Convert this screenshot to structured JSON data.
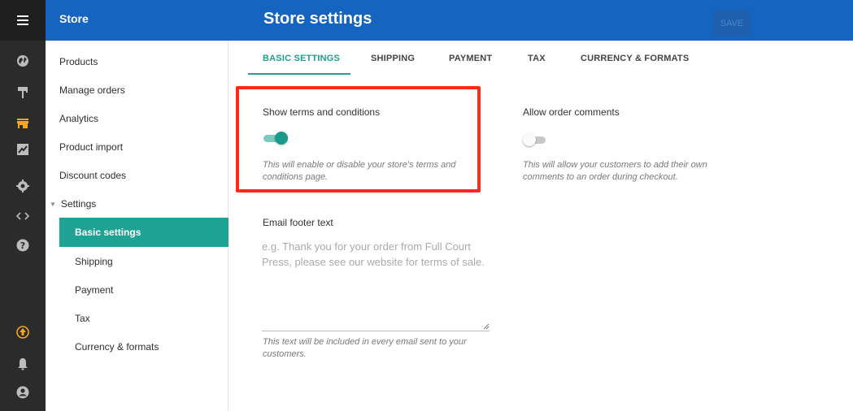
{
  "header": {
    "section": "Store",
    "title": "Store settings",
    "save_label": "SAVE"
  },
  "rail": {
    "icons": [
      "menu-icon",
      "globe-icon",
      "paint-roller-icon",
      "store-icon",
      "chart-icon",
      "gear-icon",
      "code-icon",
      "help-icon",
      "upgrade-icon",
      "bell-icon",
      "account-icon"
    ],
    "accent": "#f5a623"
  },
  "sidebar": {
    "items": [
      "Products",
      "Manage orders",
      "Analytics",
      "Product import",
      "Discount codes"
    ],
    "settings_label": "Settings",
    "sub_items": [
      "Basic settings",
      "Shipping",
      "Payment",
      "Tax",
      "Currency & formats"
    ],
    "active_sub": "Basic settings"
  },
  "tabs": [
    "BASIC SETTINGS",
    "SHIPPING",
    "PAYMENT",
    "TAX",
    "CURRENCY & FORMATS"
  ],
  "settings": {
    "terms": {
      "label": "Show terms and conditions",
      "enabled": true,
      "description": "This will enable or disable your store's terms and conditions page."
    },
    "comments": {
      "label": "Allow order comments",
      "enabled": false,
      "description": "This will allow your customers to add their own comments to an order during checkout."
    },
    "email_footer": {
      "label": "Email footer text",
      "placeholder": "e.g. Thank you for your order from Full Court Press, please see our website for terms of sale.",
      "value": "",
      "help": "This text will be included in every email sent to your customers."
    }
  },
  "colors": {
    "header": "#1565c0",
    "accent": "#1ea294",
    "highlight": "#ff2a1a"
  }
}
